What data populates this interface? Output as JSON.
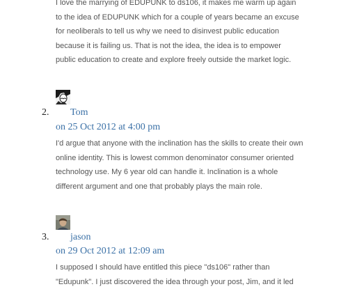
{
  "comments": [
    {
      "text_lines": [
        "I love the marrying of EDUPUNK to ds106, it makes me warm up again",
        "to the idea of EDUPUNK which for a couple of years became an excuse",
        "for neoliberals to tell us why we need to disinvest public education",
        "because it is failing us. That is not the idea, the idea is to empower",
        "public education to create and explore freely outside the market logic."
      ]
    },
    {
      "number": "2.",
      "author": "Tom",
      "date": "on 25 Oct 2012 at 4:00 pm",
      "avatar": "tom-avatar-image",
      "text_lines": [
        "I'd argue that anyone with the inclination has the skills to create their own",
        "online identity. This is lowest common denominator consumer oriented",
        "technology use. My 6 year old can handle it. Inclination is a whole",
        "different argument and one that probably plays the main role."
      ]
    },
    {
      "number": "3.",
      "author": "jason",
      "date": "on 29 Oct 2012 at 12:09 am",
      "avatar": "jason-avatar-image",
      "text_lines": [
        "I supposed I should have entitled this piece \"ds106\" rather than",
        "\"Edupunk\". I just discovered the idea through your post, Jim, and it led"
      ]
    }
  ],
  "colors": {
    "link": "#3a70a6",
    "body_text": "#555555"
  }
}
